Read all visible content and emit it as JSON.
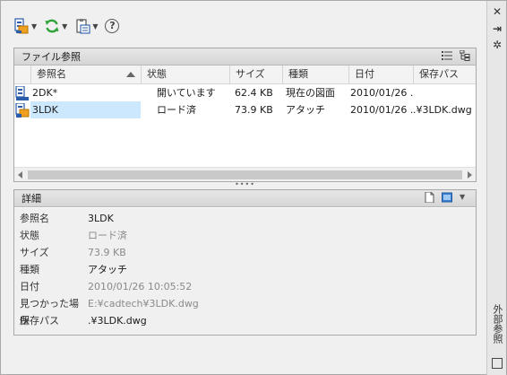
{
  "toolbar": {
    "buttons": [
      {
        "icon": "attach-dwg-icon",
        "has_dropdown": true
      },
      {
        "icon": "refresh-icon",
        "has_dropdown": true
      },
      {
        "icon": "change-path-icon",
        "has_dropdown": true
      },
      {
        "icon": "help-icon",
        "has_dropdown": false
      }
    ],
    "help_glyph": "?"
  },
  "strip": {
    "title": "外部参照",
    "close_glyph": "✕",
    "autohide_glyph": "⇥",
    "settings_glyph": "✲"
  },
  "file_refs": {
    "header": "ファイル参照",
    "columns": [
      "参照名",
      "状態",
      "サイズ",
      "種類",
      "日付",
      "保存パス"
    ],
    "rows": [
      {
        "name": "2DK*",
        "status": "開いています",
        "size": "62.4 KB",
        "type": "現在の図面",
        "date": "2010/01/26 ...",
        "path": "",
        "selected": false
      },
      {
        "name": "3LDK",
        "status": "ロード済",
        "size": "73.9 KB",
        "type": "アタッチ",
        "date": "2010/01/26 ...",
        "path": ".¥3LDK.dwg",
        "selected": true
      }
    ]
  },
  "splitter_glyph": "••••",
  "details": {
    "header": "詳細",
    "fields": [
      {
        "label": "参照名",
        "value": "3LDK",
        "dim": false
      },
      {
        "label": "状態",
        "value": "ロード済",
        "dim": true
      },
      {
        "label": "サイズ",
        "value": "73.9 KB",
        "dim": true
      },
      {
        "label": "種類",
        "value": "アタッチ",
        "dim": false
      },
      {
        "label": "日付",
        "value": "2010/01/26 10:05:52",
        "dim": true
      },
      {
        "label": "見つかった場所",
        "value": "E:¥cadtech¥3LDK.dwg",
        "dim": true
      },
      {
        "label": "保存パス",
        "value": ".¥3LDK.dwg",
        "dim": false
      }
    ]
  },
  "colors": {
    "selection": "#cce8ff",
    "refresh_green": "#2fa33a",
    "dwg_blue": "#2a5caa",
    "dwg_orange": "#f0a020"
  }
}
